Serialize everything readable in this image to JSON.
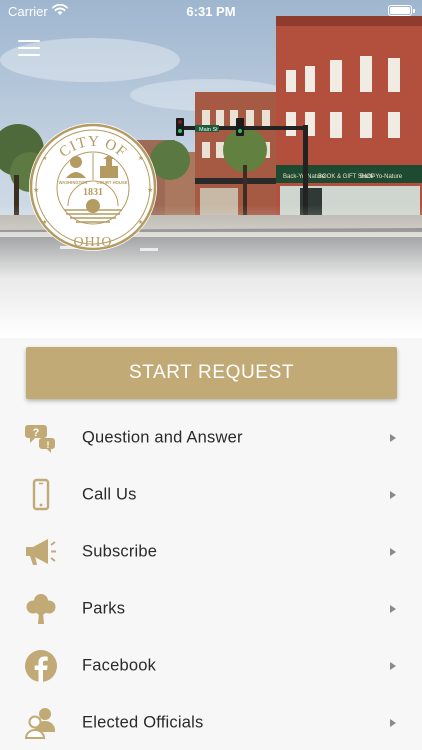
{
  "status_bar": {
    "carrier": "Carrier",
    "time": "6:31 PM"
  },
  "hero": {
    "seal": {
      "top_text": "CITY OF",
      "bottom_text": "OHIO",
      "left_label": "WASHINGTON",
      "right_label": "COURT HOUSE",
      "year": "1831"
    },
    "street_sign": "Main St",
    "storefront_signs": [
      "BOOK & GIFT SHOP",
      "Back-Yo-Nature",
      "Back-Yo-Nature"
    ]
  },
  "start_button": {
    "label": "START REQUEST"
  },
  "menu_items": [
    {
      "label": "Question and Answer",
      "icon": "question-bubbles-icon"
    },
    {
      "label": "Call Us",
      "icon": "phone-icon"
    },
    {
      "label": "Subscribe",
      "icon": "megaphone-icon"
    },
    {
      "label": "Parks",
      "icon": "tree-icon"
    },
    {
      "label": "Facebook",
      "icon": "facebook-icon"
    },
    {
      "label": "Elected Officials",
      "icon": "officials-icon"
    }
  ],
  "colors": {
    "accent": "#c1aa76",
    "icon": "#c1aa76",
    "text": "#2a2a2a",
    "background": "#f7f7f7"
  }
}
